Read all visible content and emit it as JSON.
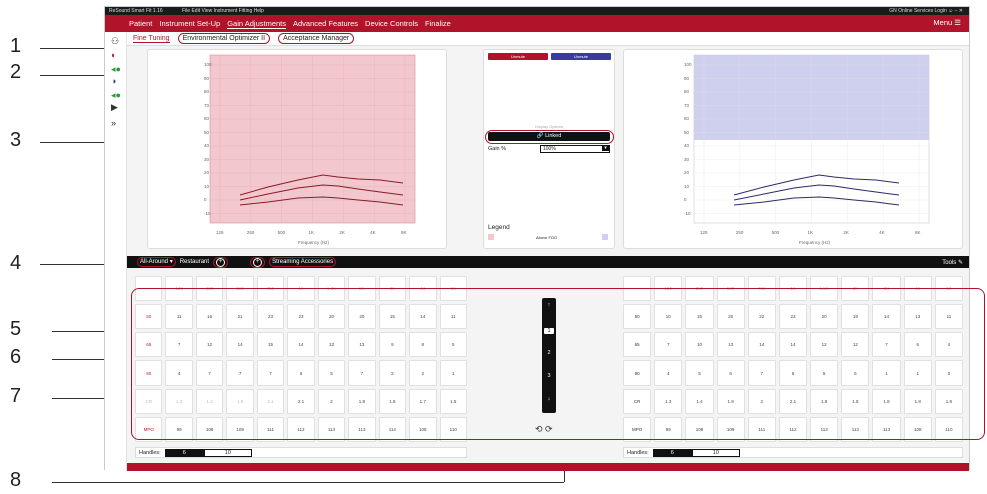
{
  "callouts": [
    "1",
    "2",
    "3",
    "4",
    "5",
    "6",
    "7",
    "8"
  ],
  "titlebar": {
    "app": "ReSound Smart Fit 1.16",
    "menus": "File   Edit   View   Instrument   Fitting   Help",
    "right": "GN Online Services  Login  ☺  –  ✕"
  },
  "nav": {
    "items": [
      "Patient",
      "Instrument Set-Up",
      "Gain Adjustments",
      "Advanced Features",
      "Device Controls",
      "Finalize"
    ],
    "menu": "Menu ☰"
  },
  "subtabs": {
    "fine": "Fine Tuning",
    "env": "Environmental Optimizer II",
    "accept": "Acceptance Manager"
  },
  "center": {
    "unmute_left": "Unmute",
    "unmute_right": "Unmute",
    "display_options": "Display Options",
    "linked": "Linked",
    "gain_label": "Gain %",
    "gain_value": "100%",
    "legend": "Legend",
    "legend_item": "Above FOG"
  },
  "graph": {
    "yticks": [
      "100",
      "90",
      "80",
      "70",
      "60",
      "50",
      "40",
      "30",
      "20",
      "10",
      "0",
      "-10"
    ],
    "xticks": [
      "125",
      "250",
      "500",
      "1K",
      "2K",
      "4K",
      "8K"
    ],
    "xlabel": "Frequency (Hz)",
    "ylabel": "dB"
  },
  "program": {
    "all_around": "All-Around",
    "restaurant": "Restaurant",
    "add": "⊕",
    "streaming": "Streaming Accessories",
    "tools": "Tools"
  },
  "table": {
    "headers": [
      "125",
      "250",
      "500",
      "750",
      "1K",
      "1.5K",
      "2K",
      "3K",
      "4K",
      "6K"
    ],
    "rows_left": [
      {
        "label": "50",
        "values": [
          "11",
          "16",
          "21",
          "23",
          "23",
          "20",
          "20",
          "15",
          "14",
          "11"
        ]
      },
      {
        "label": "65",
        "values": [
          "7",
          "12",
          "14",
          "15",
          "14",
          "13",
          "13",
          "9",
          "8",
          "5"
        ]
      },
      {
        "label": "80",
        "values": [
          "4",
          "7",
          "7",
          "7",
          "6",
          "5",
          "7",
          "2",
          "2",
          "1"
        ]
      },
      {
        "label": "CR",
        "values": [
          "1.2",
          "1.3",
          "1.8",
          "2.1",
          "2.1",
          "2",
          "1.8",
          "1.8",
          "1.7",
          "1.5"
        ]
      },
      {
        "label": "MPO",
        "values": [
          "99",
          "108",
          "109",
          "111",
          "112",
          "113",
          "113",
          "114",
          "108",
          "110"
        ]
      }
    ],
    "rows_right": [
      {
        "label": "50",
        "values": [
          "10",
          "15",
          "20",
          "22",
          "23",
          "20",
          "19",
          "14",
          "13",
          "11"
        ]
      },
      {
        "label": "65",
        "values": [
          "7",
          "10",
          "13",
          "14",
          "14",
          "12",
          "12",
          "7",
          "6",
          "4"
        ]
      },
      {
        "label": "80",
        "values": [
          "4",
          "5",
          "6",
          "7",
          "6",
          "5",
          "5",
          "1",
          "1",
          "0"
        ]
      },
      {
        "label": "CR",
        "values": [
          "1.3",
          "1.4",
          "1.9",
          "2",
          "2.1",
          "1.9",
          "1.8",
          "1.8",
          "1.8",
          "1.8"
        ]
      },
      {
        "label": "MPO",
        "values": [
          "99",
          "108",
          "109",
          "111",
          "112",
          "113",
          "113",
          "113",
          "108",
          "110"
        ]
      }
    ]
  },
  "slider": {
    "up": "↑",
    "s1": "1",
    "s2": "2",
    "s3": "3",
    "down": "↓",
    "undo": "⟲  ⟳"
  },
  "handles": {
    "label": "Handles:",
    "from": "6",
    "to": "10"
  },
  "colors": {
    "brand": "#b0142a",
    "left_ear": "#f2c8ce",
    "right_ear": "#cfd0ee"
  }
}
